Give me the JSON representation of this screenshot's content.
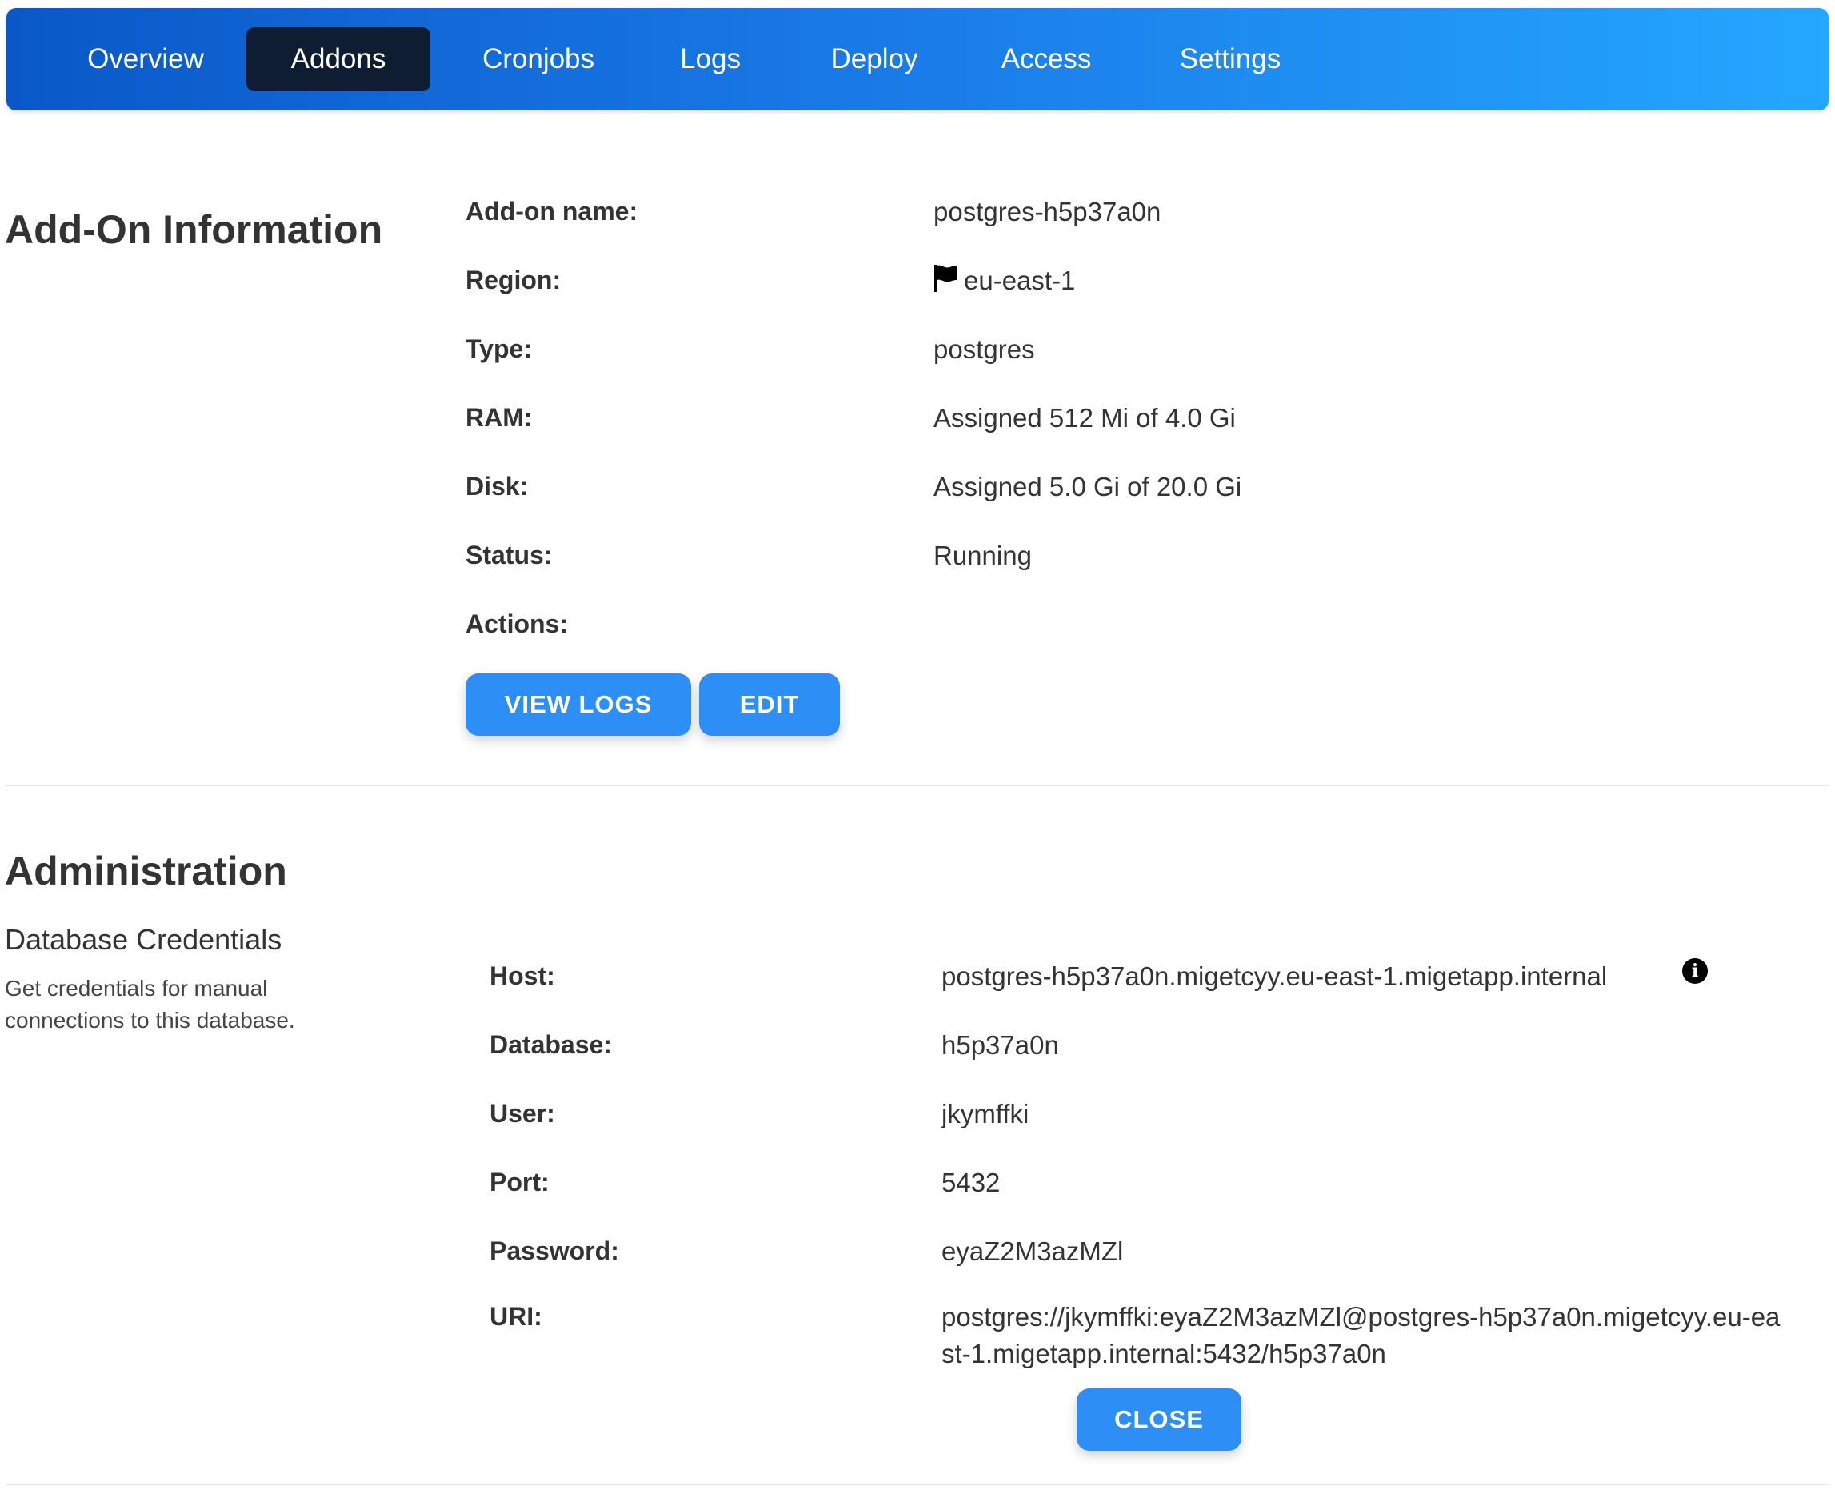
{
  "nav": {
    "tabs": [
      {
        "label": "Overview"
      },
      {
        "label": "Addons"
      },
      {
        "label": "Cronjobs"
      },
      {
        "label": "Logs"
      },
      {
        "label": "Deploy"
      },
      {
        "label": "Access"
      },
      {
        "label": "Settings"
      }
    ],
    "active": "Addons"
  },
  "info": {
    "title": "Add-On Information",
    "fields": [
      {
        "label": "Add-on name:",
        "value": "postgres-h5p37a0n"
      },
      {
        "label": "Region:",
        "value": "eu-east-1",
        "icon": "flag-icon"
      },
      {
        "label": "Type:",
        "value": "postgres"
      },
      {
        "label": "RAM:",
        "value": "Assigned 512 Mi of 4.0 Gi"
      },
      {
        "label": "Disk:",
        "value": "Assigned 5.0 Gi of 20.0 Gi"
      },
      {
        "label": "Status:",
        "value": "Running"
      },
      {
        "label": "Actions:",
        "value": ""
      }
    ],
    "view_logs_label": "VIEW LOGS",
    "edit_label": "EDIT"
  },
  "admin": {
    "title": "Administration",
    "subtitle": "Database Credentials",
    "description": "Get credentials for manual connections to this database.",
    "fields": [
      {
        "label": "Host:",
        "value": "postgres-h5p37a0n.migetcyy.eu-east-1.migetapp.internal",
        "icon": "info-icon"
      },
      {
        "label": "Database:",
        "value": "h5p37a0n"
      },
      {
        "label": "User:",
        "value": "jkymffki"
      },
      {
        "label": "Port:",
        "value": "5432"
      },
      {
        "label": "Password:",
        "value": "eyaZ2M3azMZl"
      },
      {
        "label": "URI:",
        "value": "postgres://jkymffki:eyaZ2M3azMZl@postgres-h5p37a0n.migetcyy.eu-east-1.migetapp.internal:5432/h5p37a0n"
      }
    ],
    "close_label": "CLOSE"
  },
  "colors": {
    "nav_gradient_start": "#0a58c8",
    "nav_gradient_end": "#24a7ff",
    "active_tab": "#0f1d33",
    "button": "#2d8ff5"
  }
}
